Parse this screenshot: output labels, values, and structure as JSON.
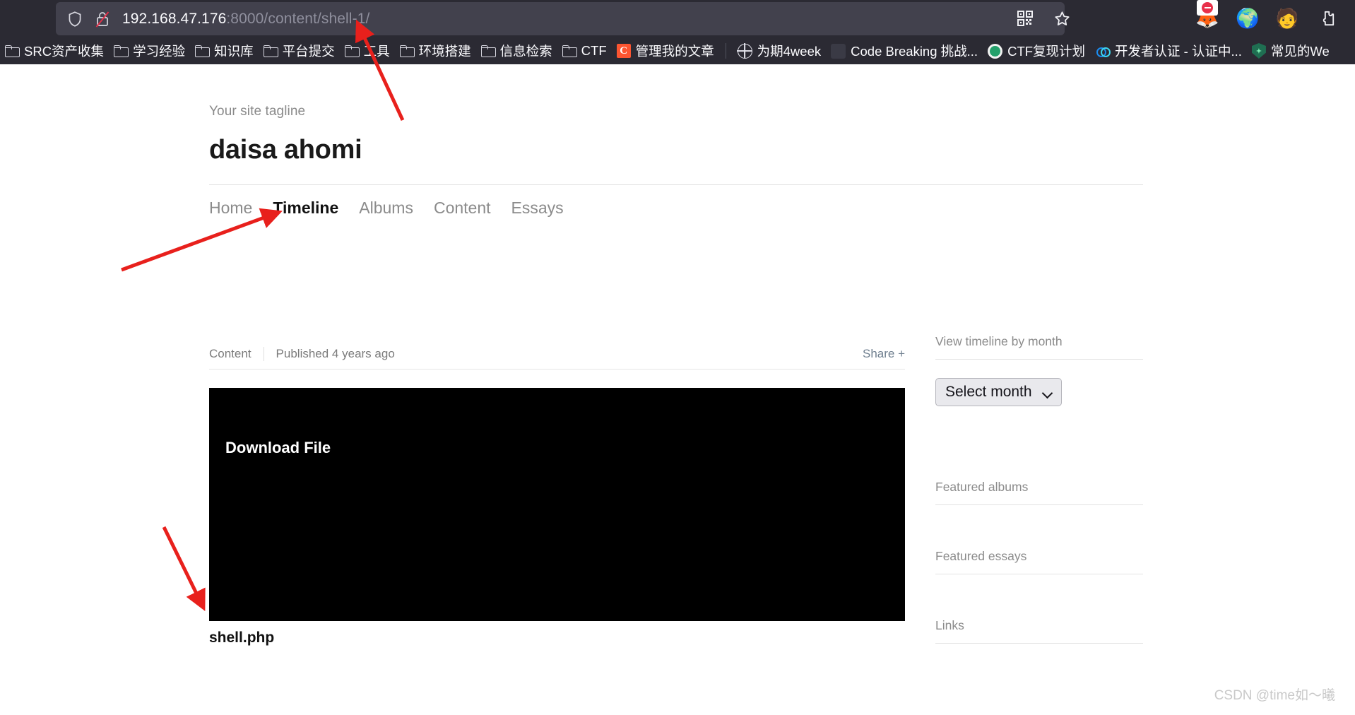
{
  "browser": {
    "url_host": "192.168.47.176",
    "url_rest": ":8000/content/shell-1/",
    "shield_icon": "shield-icon",
    "lock_icon": "lock-crossed-icon",
    "qr_icon": "qr-code-icon",
    "star_icon": "bookmark-star-icon",
    "extensions": [
      {
        "name": "foxyproxy-extension-icon",
        "glyph": "🦊"
      },
      {
        "name": "idm-download-extension-icon",
        "glyph": "🌍"
      },
      {
        "name": "user-avatar-extension-icon",
        "glyph": "🧑"
      },
      {
        "name": "puzzle-extensions-icon",
        "glyph": ""
      }
    ],
    "bookmarks": [
      {
        "label": "SRC资产收集",
        "icon": "folder-icon",
        "type": "folder"
      },
      {
        "label": "学习经验",
        "icon": "folder-icon",
        "type": "folder"
      },
      {
        "label": "知识库",
        "icon": "folder-icon",
        "type": "folder"
      },
      {
        "label": "平台提交",
        "icon": "folder-icon",
        "type": "folder"
      },
      {
        "label": "工具",
        "icon": "folder-icon",
        "type": "folder"
      },
      {
        "label": "环境搭建",
        "icon": "folder-icon",
        "type": "folder"
      },
      {
        "label": "信息检索",
        "icon": "folder-icon",
        "type": "folder"
      },
      {
        "label": "CTF",
        "icon": "folder-icon",
        "type": "folder"
      },
      {
        "label": "管理我的文章",
        "icon": "csdn-favicon",
        "type": "site"
      },
      {
        "label": "为期4week",
        "icon": "globe-favicon",
        "type": "site"
      },
      {
        "label": "Code Breaking 挑战...",
        "icon": "dark-favicon",
        "type": "site"
      },
      {
        "label": "CTF复现计划",
        "icon": "green-favicon",
        "type": "site"
      },
      {
        "label": "开发者认证 - 认证中...",
        "icon": "blue-cloud-favicon",
        "type": "site"
      },
      {
        "label": "常见的We",
        "icon": "shield-favicon",
        "type": "site"
      }
    ]
  },
  "site": {
    "tagline": "Your site tagline",
    "title": "daisa ahomi",
    "nav": [
      {
        "label": "Home",
        "active": false
      },
      {
        "label": "Timeline",
        "active": true
      },
      {
        "label": "Albums",
        "active": false
      },
      {
        "label": "Content",
        "active": false
      },
      {
        "label": "Essays",
        "active": false
      }
    ]
  },
  "post": {
    "kind": "Content",
    "published": "Published 4 years ago",
    "share_label": "Share +",
    "download_link": "Download File",
    "file_caption": "shell.php"
  },
  "sidebar": {
    "timeline_title": "View timeline by month",
    "month_select_value": "Select month",
    "chevron_icon": "chevron-down-icon",
    "blocks": [
      {
        "title": "Featured albums"
      },
      {
        "title": "Featured essays"
      },
      {
        "title": "Links"
      }
    ]
  },
  "watermark": "CSDN @time如～曦",
  "colors": {
    "chrome_bg": "#2b2a33",
    "urlbar_bg": "#42414d",
    "accent_red": "#e8201c",
    "media_block": "#000000",
    "muted_text": "#8b8b8b"
  }
}
